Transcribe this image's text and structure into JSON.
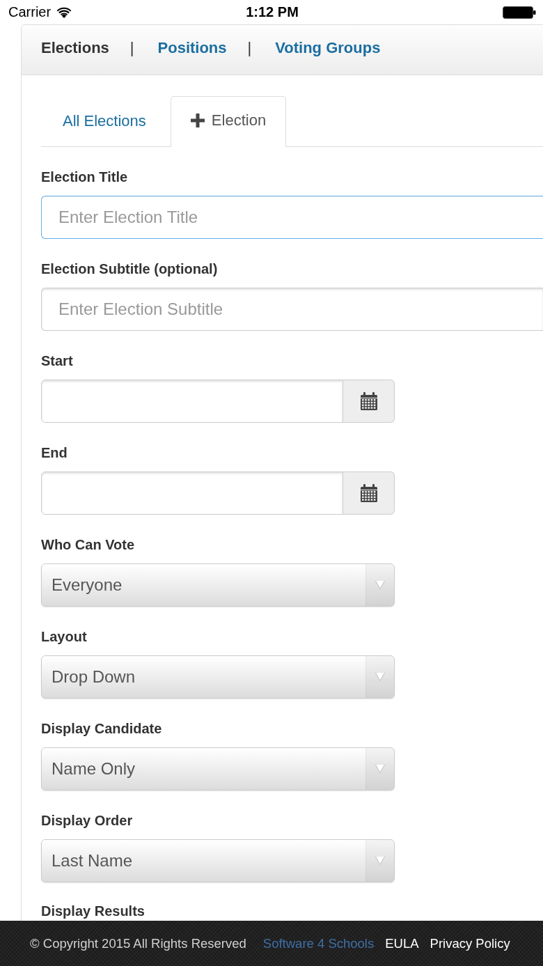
{
  "status_bar": {
    "carrier": "Carrier",
    "time": "1:12 PM"
  },
  "nav": {
    "items": [
      {
        "label": "Elections",
        "selected": true
      },
      {
        "label": "Positions",
        "selected": false
      },
      {
        "label": "Voting Groups",
        "selected": false
      }
    ],
    "separators": [
      "|",
      "|"
    ]
  },
  "tabs": [
    {
      "label": "All Elections",
      "kind": "plain",
      "selected": false
    },
    {
      "label": "Election",
      "kind": "add",
      "selected": true
    }
  ],
  "form": {
    "fields": [
      {
        "kind": "text",
        "label": "Election Title",
        "placeholder": "Enter Election Title",
        "focused": true
      },
      {
        "kind": "text",
        "label": "Election Subtitle (optional)",
        "placeholder": "Enter Election Subtitle",
        "focused": false
      },
      {
        "kind": "date",
        "label": "Start"
      },
      {
        "kind": "date",
        "label": "End"
      },
      {
        "kind": "select",
        "label": "Who Can Vote",
        "value": "Everyone"
      },
      {
        "kind": "select",
        "label": "Layout",
        "value": "Drop Down"
      },
      {
        "kind": "select",
        "label": "Display Candidate",
        "value": "Name Only"
      },
      {
        "kind": "select",
        "label": "Display Order",
        "value": "Last Name"
      }
    ],
    "next_label": "Display Results"
  },
  "footer": {
    "copyright": "© Copyright 2015 All Rights Reserved",
    "links": [
      {
        "label": "Software 4 Schools",
        "kind": "brand"
      },
      {
        "label": "EULA",
        "kind": "plain"
      },
      {
        "label": "Privacy Policy",
        "kind": "plain"
      }
    ]
  }
}
